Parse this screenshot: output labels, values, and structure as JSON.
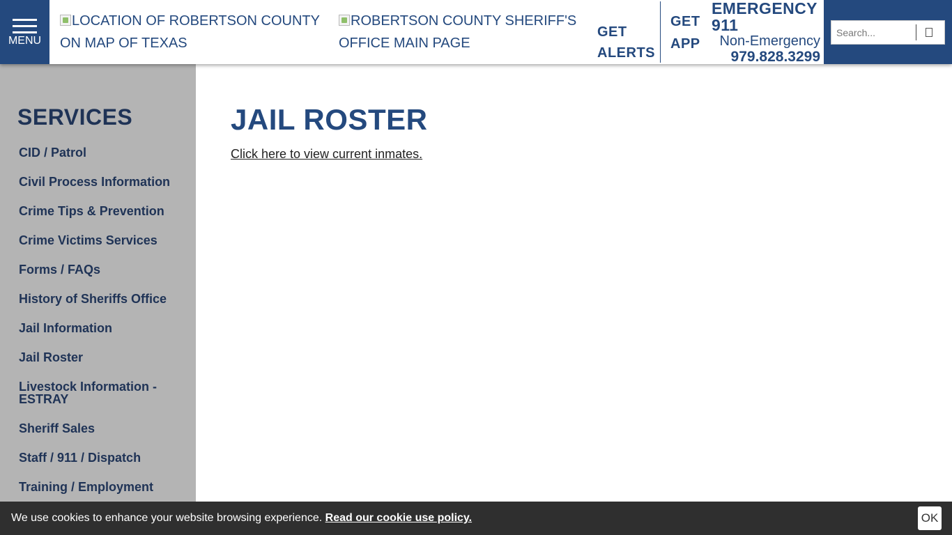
{
  "header": {
    "menu_label": "MENU",
    "logo_county_alt": "Location of Robertson County on map of Texas",
    "logo_office_alt": "Robertson County Sheriff's Office Main Page",
    "get_alerts_line1": "GET",
    "get_alerts_line2": "ALERTS",
    "get_app_line1": "GET",
    "get_app_line2": "APP",
    "emergency_title": "EMERGENCY\n911",
    "non_emergency_label": "Non-Emergency",
    "non_emergency_number": "979.828.3299",
    "search_placeholder": "Search..."
  },
  "sidebar": {
    "heading": "SERVICES",
    "items": [
      {
        "label": "CID / Patrol"
      },
      {
        "label": "Civil Process Information"
      },
      {
        "label": "Crime Tips & Prevention"
      },
      {
        "label": "Crime Victims Services"
      },
      {
        "label": "Forms / FAQs"
      },
      {
        "label": "History of Sheriffs Office"
      },
      {
        "label": "Jail Information"
      },
      {
        "label": "Jail Roster"
      },
      {
        "label": "Livestock Information - ESTRAY"
      },
      {
        "label": "Sheriff Sales"
      },
      {
        "label": "Staff / 911 / Dispatch"
      },
      {
        "label": "Training / Employment"
      }
    ]
  },
  "main": {
    "title": "JAIL ROSTER",
    "link_text": "Click here to view current inmates."
  },
  "cookie": {
    "message": "We use cookies to enhance your website browsing experience.",
    "policy_link": "Read our cookie use policy.",
    "ok_label": "OK"
  },
  "colors": {
    "brand_blue": "#24497e",
    "sidebar_bg": "#b4b4b4",
    "sidebar_text": "#1f3356",
    "cookie_bg": "#2f2f2f"
  }
}
